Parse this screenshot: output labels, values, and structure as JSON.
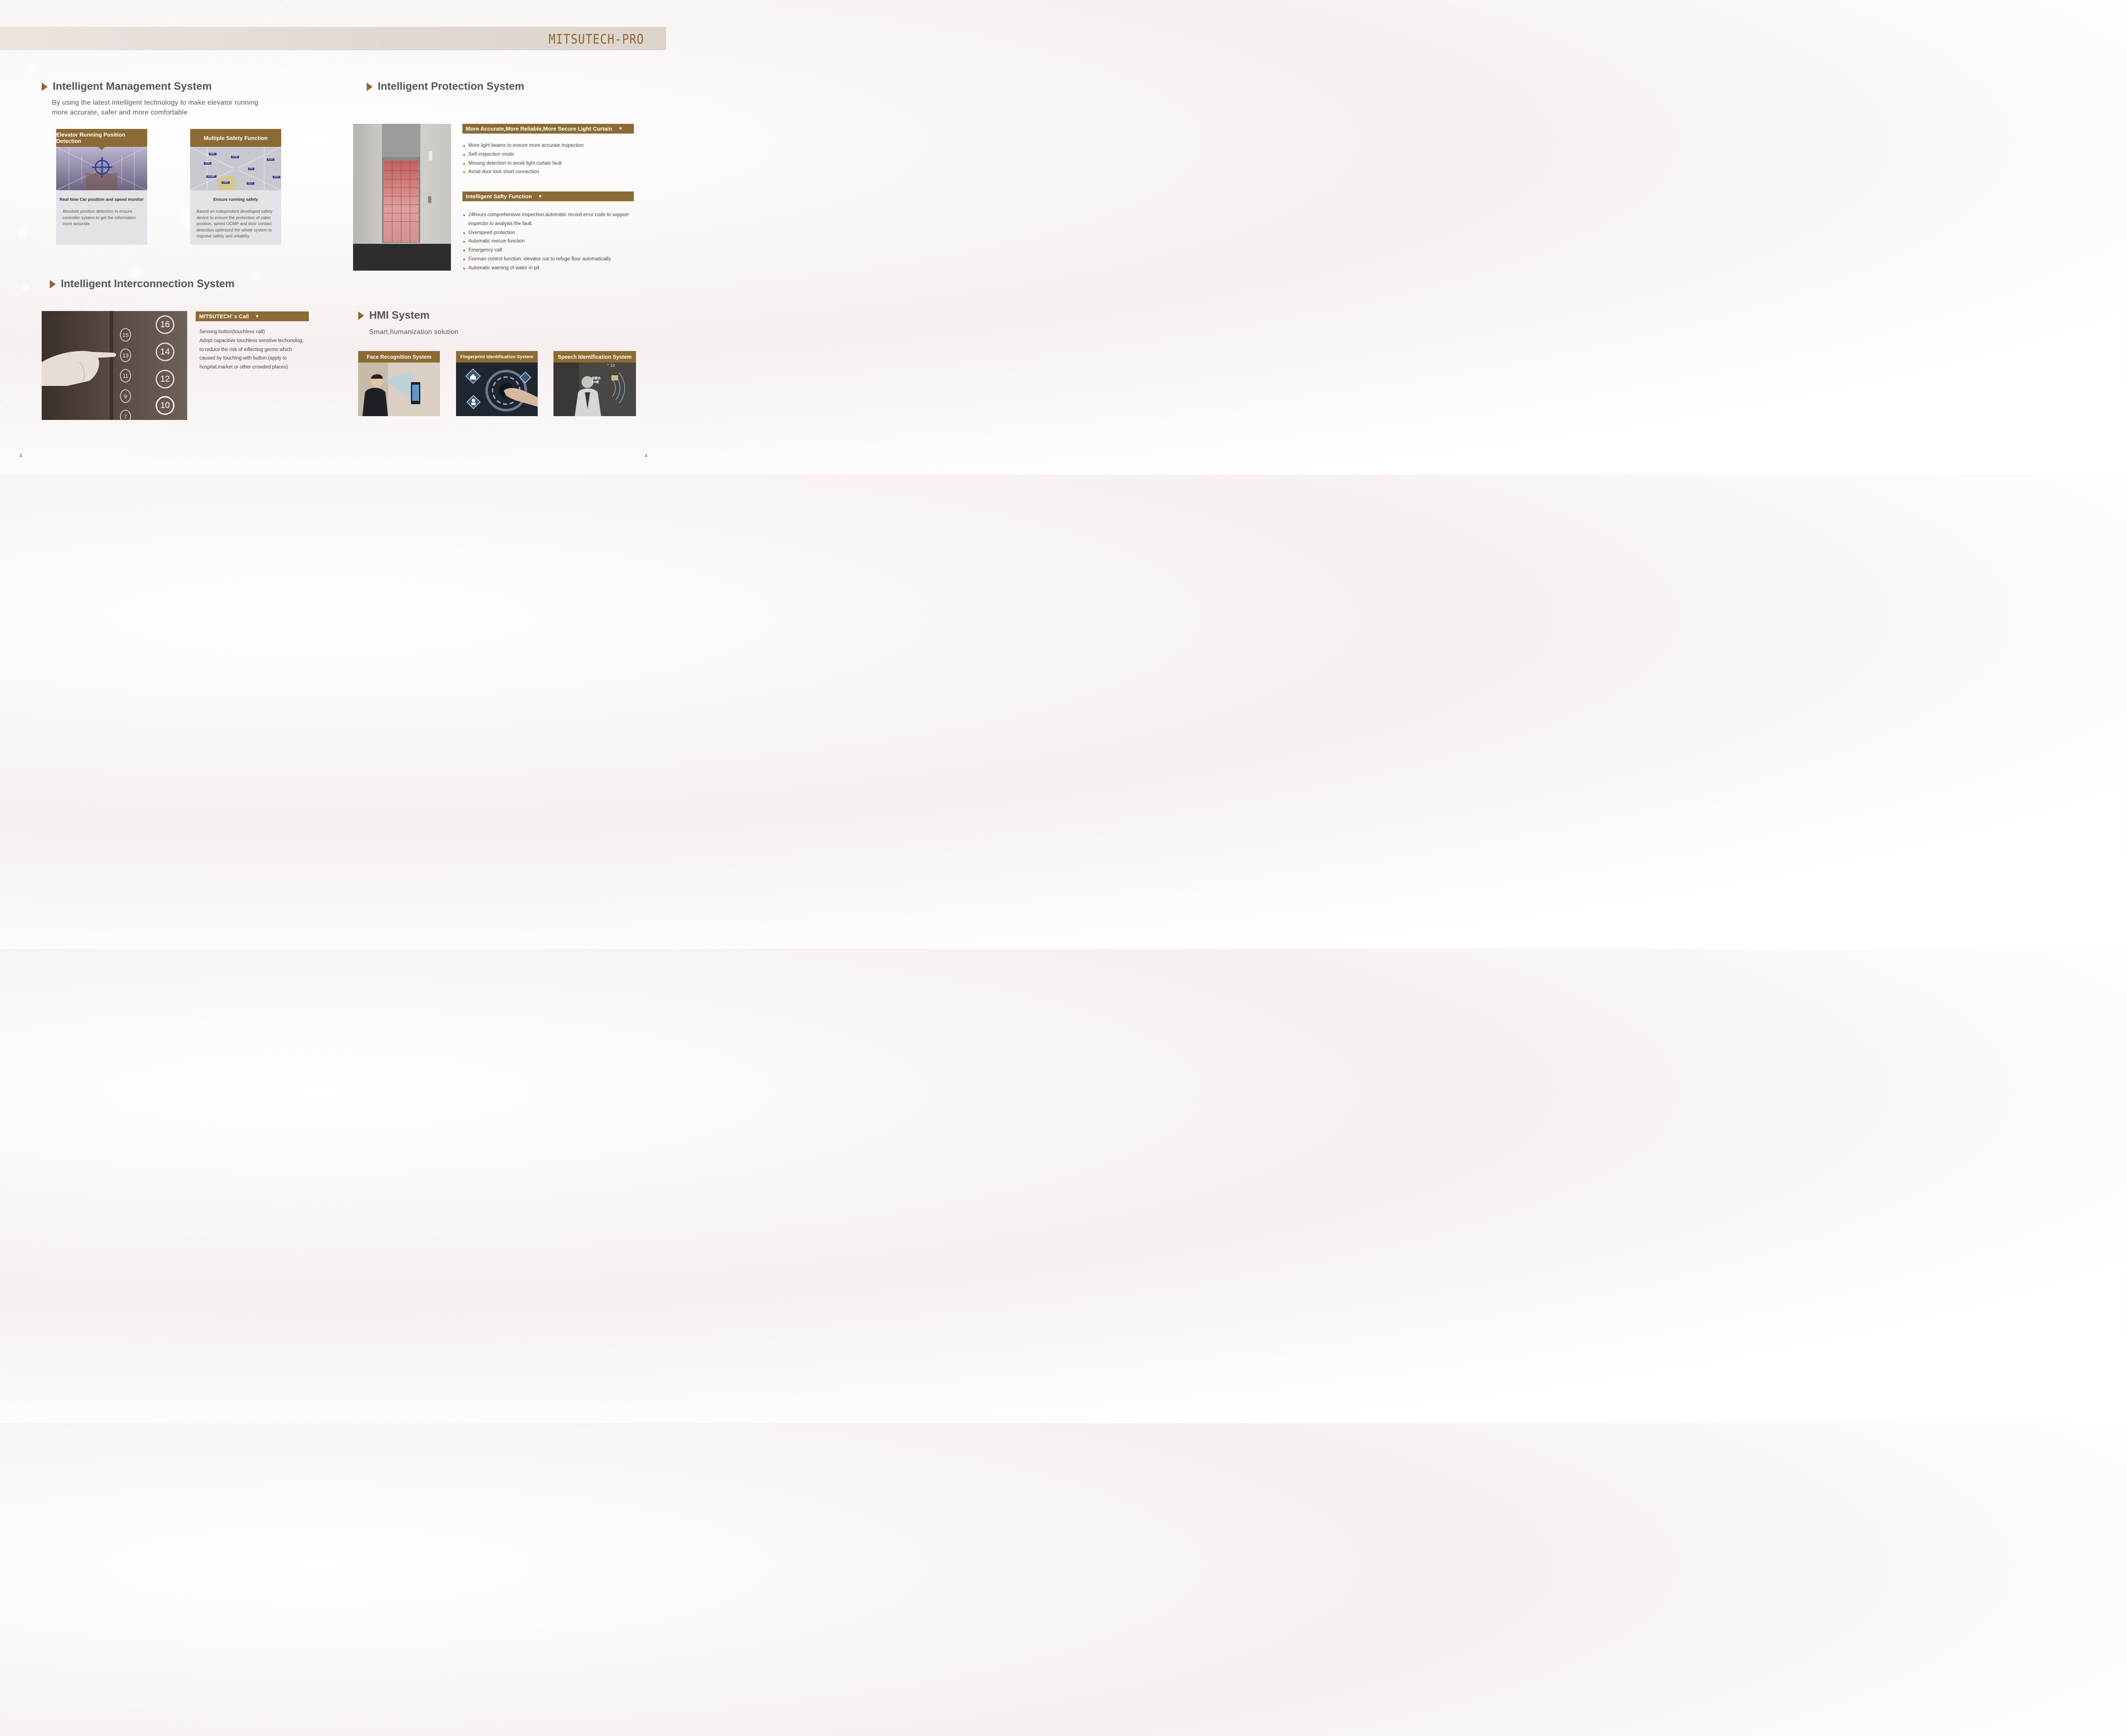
{
  "brand": "MITSUTECH-PRO",
  "management": {
    "title": "Intelligent Management System",
    "subtitle_line1": "By using the latest intelligent technology to make elevator running",
    "subtitle_line2": "more accurate, safer and more comfortable",
    "cards": [
      {
        "title": "Elevator Running Position Detection",
        "subtitle": "Real time Car position and speed monitor",
        "body": "Absolute position detection to ensure controller system to get the information more accurate"
      },
      {
        "title": "Multiple Safety Function",
        "subtitle": "Ensure running safety",
        "body": "Based on independent developed safety device to ensure the protection of cabin position, speed UCMP and  door contact detection.optimized the whole system to improve safety and reliablity",
        "tags": [
          "ARL",
          "DOB",
          "ESC",
          "PSP",
          "OV",
          "UCMP",
          "OSP",
          "RSP",
          "SET"
        ]
      }
    ]
  },
  "protection": {
    "title": "Intelligent Protection System",
    "light_curtain_title": "More Accurate,More Reliable,More Secure Light Curtain",
    "light_curtain_items": [
      "More light beams to ensure more accurate inspection",
      "Self-inspection mode",
      "Missing detection to avoid light curtain fault",
      "Avoid door lock short connection"
    ],
    "safety_title": "Intelligent Safty Function",
    "safety_items": [
      "24hours comprehensive inspection:automatic record error code to support inspector to analysis the fault.",
      "Overspeed protection",
      "Automatic rescue function",
      "Emergency call",
      "Fireman control function: elevator run to refuge floor automatically",
      "Automatic warning of water in pit"
    ]
  },
  "interconnection": {
    "title": "Intelligent Interconnection System",
    "call_title": "MITSUTECH’ s Call",
    "call_lines": [
      "Sensing button(touchless call)",
      "Adopt capacitive touchless senstive techonolog,",
      "to reduce the risk of inflecting germs which",
      "caused by touching with button.(apply to",
      "hospital,market or other crowded places)"
    ],
    "buttons": [
      "16",
      "15",
      "14",
      "13",
      "12",
      "11",
      "10",
      "9",
      "7"
    ]
  },
  "hmi": {
    "title": "HMI System",
    "subtitle": "Smart,humanization solution",
    "cards": [
      {
        "title": "Face Recognition System"
      },
      {
        "title": "Fingerprint Identification System"
      },
      {
        "title": "Speech Identification System",
        "overlay_text": "我要去\n10樓",
        "floor": "10"
      }
    ]
  },
  "page_numbers": {
    "left": "3",
    "right": "4"
  },
  "colors": {
    "accent": "#8d6a33",
    "heading": "#555555"
  },
  "icons": [
    "play-triangle-icon",
    "dropdown-arrow-icon",
    "crosshair-icon",
    "home-icon",
    "person-icon",
    "cloud-icon"
  ]
}
